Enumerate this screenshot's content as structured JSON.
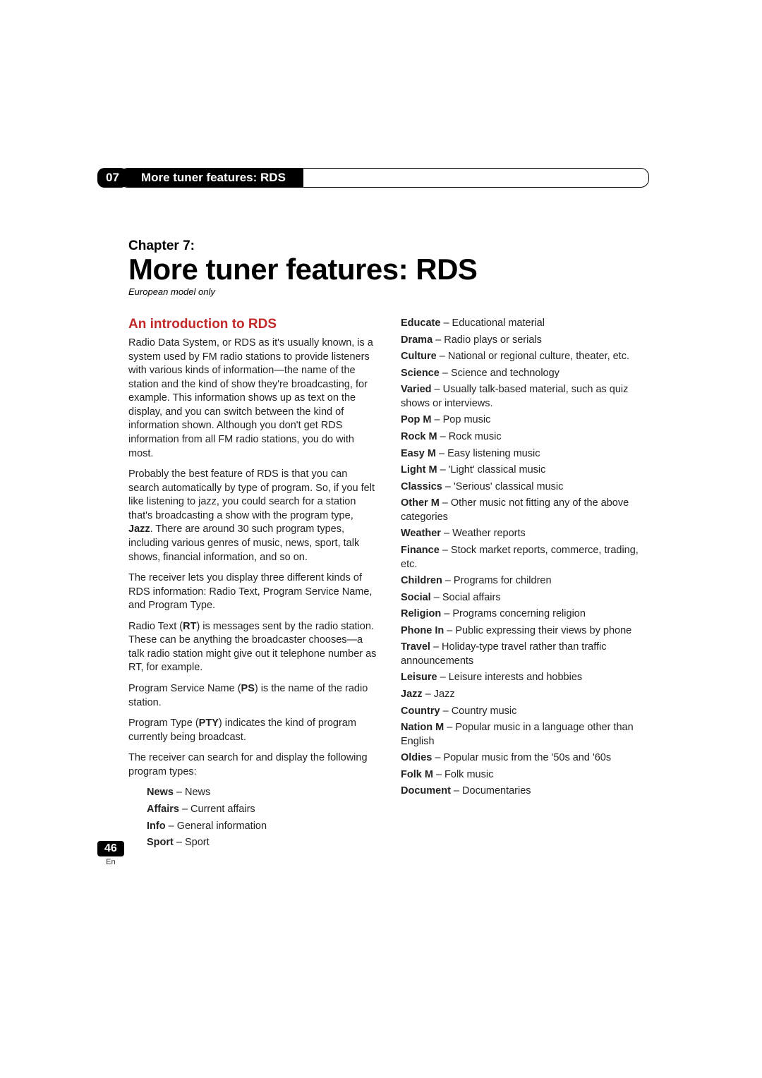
{
  "header": {
    "chapter_number": "07",
    "chapter_strip_title": "More tuner features: RDS"
  },
  "title_block": {
    "chapter_label": "Chapter 7:",
    "chapter_title": "More tuner features: RDS",
    "note": "European model only"
  },
  "section": {
    "heading": "An introduction to RDS",
    "p1": "Radio Data System, or RDS as it's usually known, is a system used by FM radio stations to provide listeners with various kinds of information—the name of the station and the kind of show they're broadcasting, for example. This information shows up as text on the display, and you can switch between the kind of information shown. Although you don't get RDS information from all FM radio stations, you do with most.",
    "p2_pre": "Probably the best feature of RDS is that you can search automatically by type of program. So, if you felt like listening to jazz, you could search for a station that's broadcasting a show with the program type, ",
    "p2_bold": "Jazz",
    "p2_post": ". There are around 30 such program types, including various genres of music, news, sport, talk shows, financial information, and so on.",
    "p3": "The receiver lets you display three different kinds of RDS information: Radio Text, Program Service Name, and Program Type.",
    "p4_pre": "Radio Text (",
    "p4_bold": "RT",
    "p4_post": ") is messages sent by the radio station. These can be anything the broadcaster chooses—a talk radio station might give out it telephone number as RT, for example.",
    "p5_pre": "Program Service Name (",
    "p5_bold": "PS",
    "p5_post": ") is the name of the radio station.",
    "p6_pre": "Program Type (",
    "p6_bold": "PTY",
    "p6_post": ") indicates the kind of program currently being broadcast.",
    "p7": "The receiver can search for and display the following program types:"
  },
  "types_left": [
    {
      "name": "News",
      "desc": "News"
    },
    {
      "name": "Affairs",
      "desc": "Current affairs"
    },
    {
      "name": "Info",
      "desc": "General information"
    },
    {
      "name": "Sport",
      "desc": "Sport"
    }
  ],
  "types_right": [
    {
      "name": "Educate",
      "desc": "Educational material"
    },
    {
      "name": "Drama",
      "desc": "Radio plays or serials"
    },
    {
      "name": "Culture",
      "desc": "National or regional culture, theater, etc."
    },
    {
      "name": "Science",
      "desc": "Science and technology"
    },
    {
      "name": "Varied",
      "desc": "Usually talk-based material, such as quiz shows or interviews."
    },
    {
      "name": "Pop M",
      "desc": "Pop music"
    },
    {
      "name": "Rock M",
      "desc": "Rock music"
    },
    {
      "name": "Easy M",
      "desc": "Easy listening music"
    },
    {
      "name": "Light M",
      "desc": "'Light' classical music"
    },
    {
      "name": "Classics",
      "desc": "'Serious' classical music"
    },
    {
      "name": "Other M",
      "desc": "Other music not fitting any of the above categories"
    },
    {
      "name": "Weather",
      "desc": "Weather reports"
    },
    {
      "name": "Finance",
      "desc": "Stock market reports, commerce, trading, etc."
    },
    {
      "name": "Children",
      "desc": "Programs for children"
    },
    {
      "name": "Social",
      "desc": "Social affairs"
    },
    {
      "name": "Religion",
      "desc": "Programs concerning religion"
    },
    {
      "name": "Phone In",
      "desc": "Public expressing their views by phone"
    },
    {
      "name": "Travel",
      "desc": "Holiday-type travel rather than traffic announcements"
    },
    {
      "name": "Leisure",
      "desc": "Leisure interests and hobbies"
    },
    {
      "name": "Jazz",
      "desc": "Jazz"
    },
    {
      "name": "Country",
      "desc": "Country music"
    },
    {
      "name": "Nation M",
      "desc": "Popular music in a language other than English"
    },
    {
      "name": "Oldies",
      "desc": "Popular music from the '50s and '60s"
    },
    {
      "name": "Folk M",
      "desc": "Folk music"
    },
    {
      "name": "Document",
      "desc": "Documentaries"
    }
  ],
  "footer": {
    "page_number": "46",
    "lang": "En"
  }
}
